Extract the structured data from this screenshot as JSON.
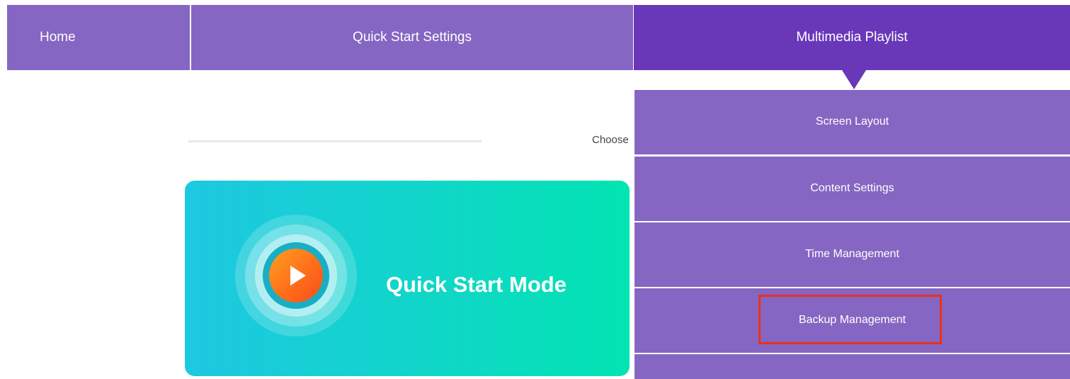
{
  "nav": {
    "home_label": "Home",
    "quick_start_settings_label": "Quick Start Settings",
    "multimedia_playlist_label": "Multimedia Playlist",
    "active_tab": "Multimedia Playlist"
  },
  "main": {
    "choose_text": "Choose",
    "hero": {
      "title": "Quick Start Mode",
      "icon": "play-icon"
    }
  },
  "dropdown": {
    "items": [
      {
        "label": "Screen Layout"
      },
      {
        "label": "Content Settings"
      },
      {
        "label": "Time Management"
      },
      {
        "label": "Backup Management"
      },
      {
        "label": ""
      }
    ],
    "highlighted_item": "Backup Management"
  },
  "colors": {
    "nav_bg": "#8566c2",
    "nav_active_bg": "#6838b9",
    "hero_gradient_start": "#1ec8e2",
    "hero_gradient_end": "#02e4b2",
    "play_button": "#ff6a1a",
    "highlight_border": "#e8321e"
  }
}
